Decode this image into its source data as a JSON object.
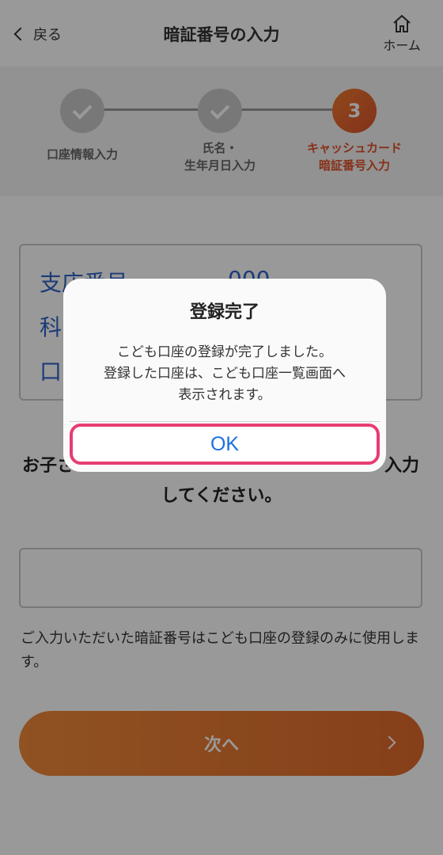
{
  "header": {
    "back_label": "戻る",
    "title": "暗証番号の入力",
    "home_label": "ホーム"
  },
  "stepper": {
    "steps": [
      {
        "label_line1": "口座情報入力",
        "label_line2": "",
        "status": "done"
      },
      {
        "label_line1": "氏名・",
        "label_line2": "生年月日入力",
        "status": "done"
      },
      {
        "label_line1": "キャッシュカード",
        "label_line2": "暗証番号入力",
        "status": "current",
        "number": "3"
      }
    ],
    "active_color": "#e0522a"
  },
  "account_info": {
    "rows": [
      {
        "label": "支店番号",
        "value": "000"
      },
      {
        "label": "科",
        "value": ""
      },
      {
        "label": "口",
        "value": ""
      }
    ]
  },
  "instruction": {
    "line1": "お子さ",
    "line1_end": "入力",
    "line2": "してください。"
  },
  "note": "ご入力いただいた暗証番号はこども口座の登録のみに使用します。",
  "next_button": {
    "label": "次へ"
  },
  "dialog": {
    "title": "登録完了",
    "message_lines": [
      "こども口座の登録が完了しました。",
      "登録した口座は、こども口座一覧画面へ",
      "表示されます。"
    ],
    "ok_label": "OK",
    "highlight_color": "#e83c72"
  }
}
